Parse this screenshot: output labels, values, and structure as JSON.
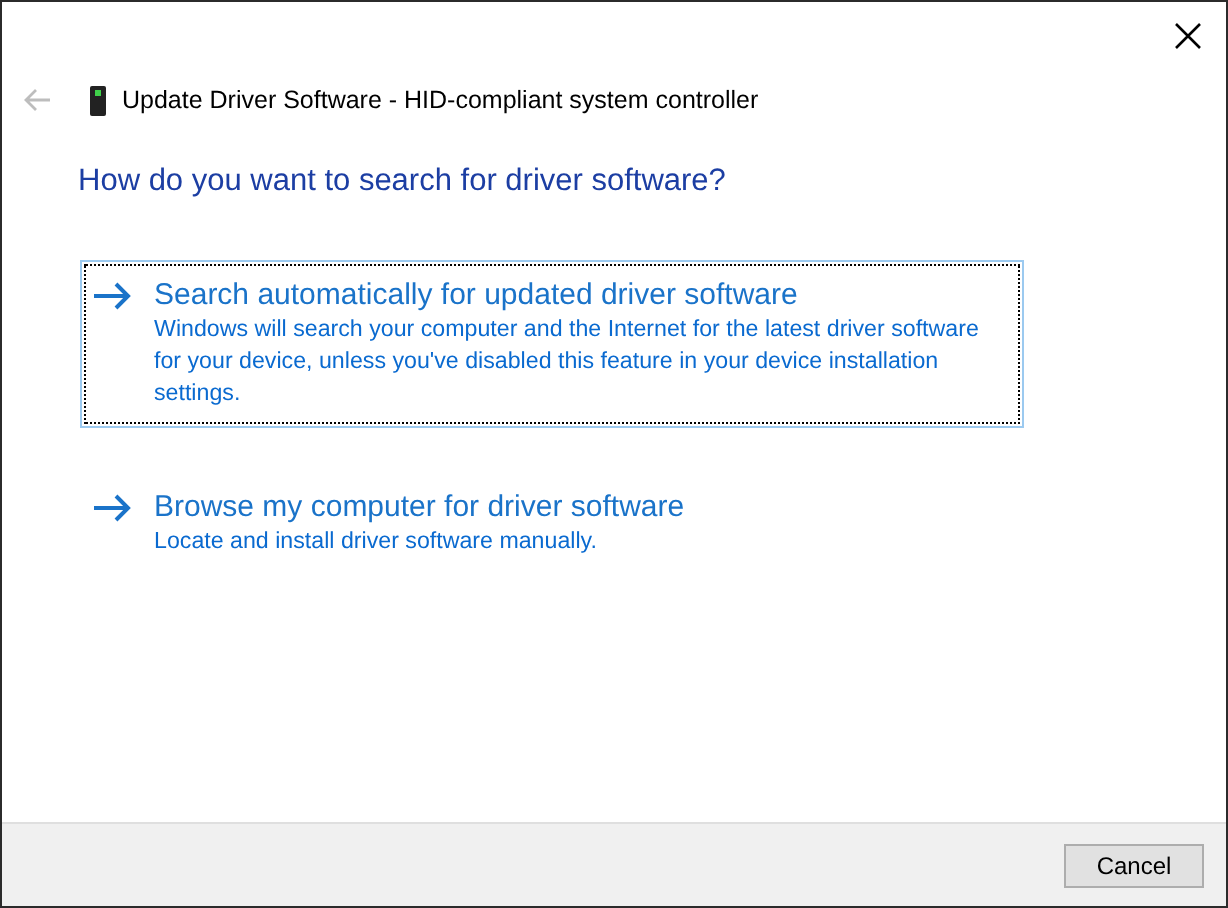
{
  "window": {
    "title": "Update Driver Software - HID-compliant system controller"
  },
  "heading": "How do you want to search for driver software?",
  "options": [
    {
      "title": "Search automatically for updated driver software",
      "description": "Windows will search your computer and the Internet for the latest driver software for your device, unless you've disabled this feature in your device installation settings.",
      "selected": true
    },
    {
      "title": "Browse my computer for driver software",
      "description": "Locate and install driver software manually.",
      "selected": false
    }
  ],
  "buttons": [
    "Cancel"
  ]
}
